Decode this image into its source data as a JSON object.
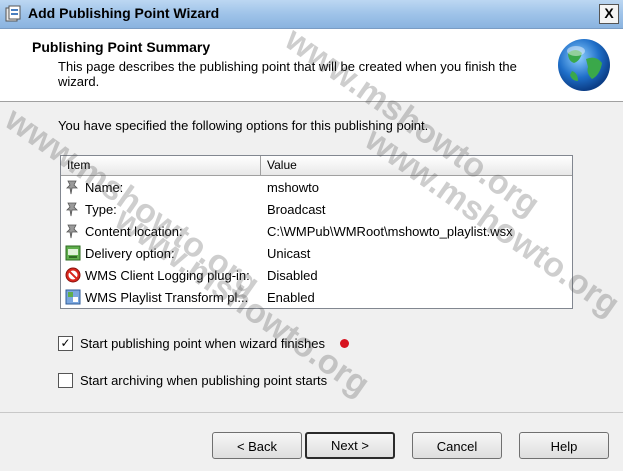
{
  "window": {
    "title": "Add Publishing Point Wizard",
    "close_label": "X"
  },
  "header": {
    "title": "Publishing Point Summary",
    "description": "This page describes the publishing point that will be created when you finish the wizard."
  },
  "intro": "You have specified the following options for this publishing point.",
  "list": {
    "col_item": "Item",
    "col_value": "Value",
    "rows": [
      {
        "icon": "pin-icon",
        "item": "Name:",
        "value": "mshowto"
      },
      {
        "icon": "pin-icon",
        "item": "Type:",
        "value": "Broadcast"
      },
      {
        "icon": "pin-icon",
        "item": "Content location:",
        "value": "C:\\WMPub\\WMRoot\\mshowto_playlist.wsx"
      },
      {
        "icon": "delivery-icon",
        "item": "Delivery option:",
        "value": "Unicast"
      },
      {
        "icon": "disabled-plugin-icon",
        "item": "WMS Client Logging plug-in:",
        "value": "Disabled"
      },
      {
        "icon": "plugin-icon",
        "item": "WMS Playlist Transform pl...",
        "value": "Enabled"
      }
    ]
  },
  "options": {
    "start_label": "Start publishing point when wizard finishes",
    "start_checked": true,
    "archive_label": "Start archiving when publishing point starts",
    "archive_checked": false
  },
  "buttons": {
    "back": "< Back",
    "next": "Next >",
    "cancel": "Cancel",
    "help": "Help"
  },
  "watermark": "www.mshowto.org",
  "colors": {
    "title_bar": "#9fc3e9",
    "marker_red": "#d7131f"
  }
}
